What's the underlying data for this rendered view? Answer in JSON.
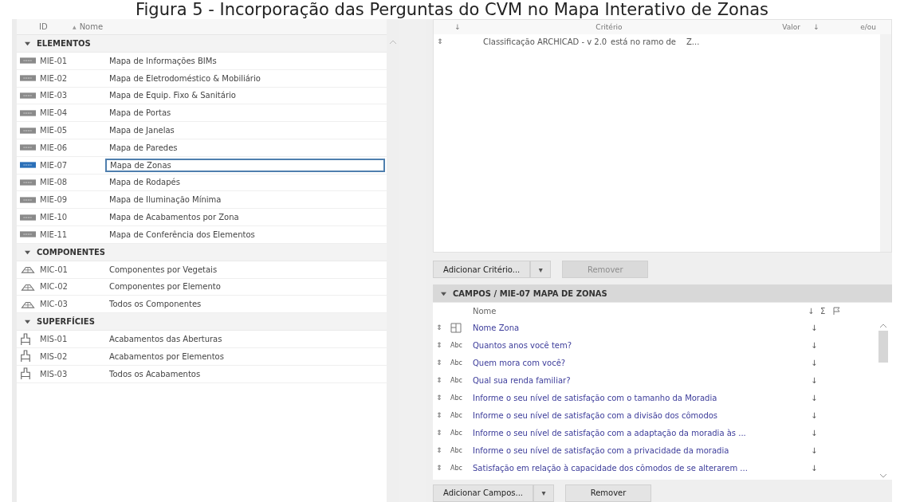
{
  "caption": "Figura 5 - Incorporação das Perguntas do CVM no Mapa Interativo de Zonas",
  "navigator": {
    "columns": [
      "ID",
      "Nome"
    ],
    "sort_mark": "▲",
    "groups": [
      {
        "title": "ELEMENTOS",
        "expanded": true,
        "kind": "element",
        "items": [
          {
            "id": "MIE-01",
            "name": "Mapa de Informações BIMs",
            "selected": false
          },
          {
            "id": "MIE-02",
            "name": "Mapa de Eletrodoméstico & Mobiliário",
            "selected": false
          },
          {
            "id": "MIE-03",
            "name": "Mapa de Equip. Fixo & Sanitário",
            "selected": false
          },
          {
            "id": "MIE-04",
            "name": "Mapa de Portas",
            "selected": false
          },
          {
            "id": "MIE-05",
            "name": "Mapa de Janelas",
            "selected": false
          },
          {
            "id": "MIE-06",
            "name": "Mapa de Paredes",
            "selected": false
          },
          {
            "id": "MIE-07",
            "name": "Mapa de Zonas",
            "selected": true
          },
          {
            "id": "MIE-08",
            "name": "Mapa de Rodapés",
            "selected": false
          },
          {
            "id": "MIE-09",
            "name": "Mapa de Iluminação Mínima",
            "selected": false
          },
          {
            "id": "MIE-10",
            "name": "Mapa de Acabamentos por Zona",
            "selected": false
          },
          {
            "id": "MIE-11",
            "name": "Mapa de Conferência dos Elementos",
            "selected": false
          }
        ]
      },
      {
        "title": "COMPONENTES",
        "expanded": true,
        "kind": "component",
        "items": [
          {
            "id": "MIC-01",
            "name": "Componentes por Vegetais",
            "selected": false
          },
          {
            "id": "MIC-02",
            "name": "Componentes por Elemento",
            "selected": false
          },
          {
            "id": "MIC-03",
            "name": "Todos os Componentes",
            "selected": false
          }
        ]
      },
      {
        "title": "SUPERFÍCIES",
        "expanded": true,
        "kind": "surface",
        "items": [
          {
            "id": "MIS-01",
            "name": "Acabamentos das Aberturas",
            "selected": false
          },
          {
            "id": "MIS-02",
            "name": "Acabamentos por Elementos",
            "selected": false
          },
          {
            "id": "MIS-03",
            "name": "Todos os Acabamentos",
            "selected": false
          }
        ]
      }
    ]
  },
  "criteria": {
    "columns": [
      "↓",
      "Critério",
      "Valor",
      "↓",
      "e/ou"
    ],
    "rows": [
      {
        "handle": "⇕",
        "criterion": "Classificação ARCHICAD - v 2.0",
        "operator": "está no ramo de",
        "value": "Z..."
      }
    ],
    "buttons": [
      {
        "label": "Adicionar Critério...",
        "dropdown": "▾",
        "disabled": false
      },
      {
        "label": "Remover",
        "disabled": true
      }
    ]
  },
  "fields": {
    "title": "CAMPOS / MIE-07 MAPA DE ZONAS",
    "expanded": true,
    "columns": [
      "Nome",
      "↓",
      "Σ"
    ],
    "rows": [
      {
        "kind": "zone",
        "name": "Nome Zona",
        "sort": "↓"
      },
      {
        "kind": "text",
        "type_label": "Abc",
        "name": "Quantos anos você tem?",
        "sort": "↓"
      },
      {
        "kind": "text",
        "type_label": "Abc",
        "name": "Quem mora com você?",
        "sort": "↓"
      },
      {
        "kind": "text",
        "type_label": "Abc",
        "name": "Qual sua renda familiar?",
        "sort": "↓"
      },
      {
        "kind": "text",
        "type_label": "Abc",
        "name": "Informe o seu nível de satisfação com o tamanho da Moradia",
        "sort": "↓"
      },
      {
        "kind": "text",
        "type_label": "Abc",
        "name": "Informe o seu nível de satisfação com a divisão dos cômodos",
        "sort": "↓"
      },
      {
        "kind": "text",
        "type_label": "Abc",
        "name": "Informe o seu nível de satisfação com a adaptação da moradia às ...",
        "sort": "↓"
      },
      {
        "kind": "text",
        "type_label": "Abc",
        "name": "Informe o seu nível de satisfação com a privacidade da moradia",
        "sort": "↓"
      },
      {
        "kind": "text",
        "type_label": "Abc",
        "name": "Satisfação em relação à capacidade dos cômodos de se alterarem ...",
        "sort": "↓"
      }
    ],
    "handle": "⇕",
    "buttons": [
      {
        "label": "Adicionar Campos...",
        "dropdown": "▾",
        "disabled": false
      },
      {
        "label": "Remover",
        "disabled": false
      }
    ]
  }
}
